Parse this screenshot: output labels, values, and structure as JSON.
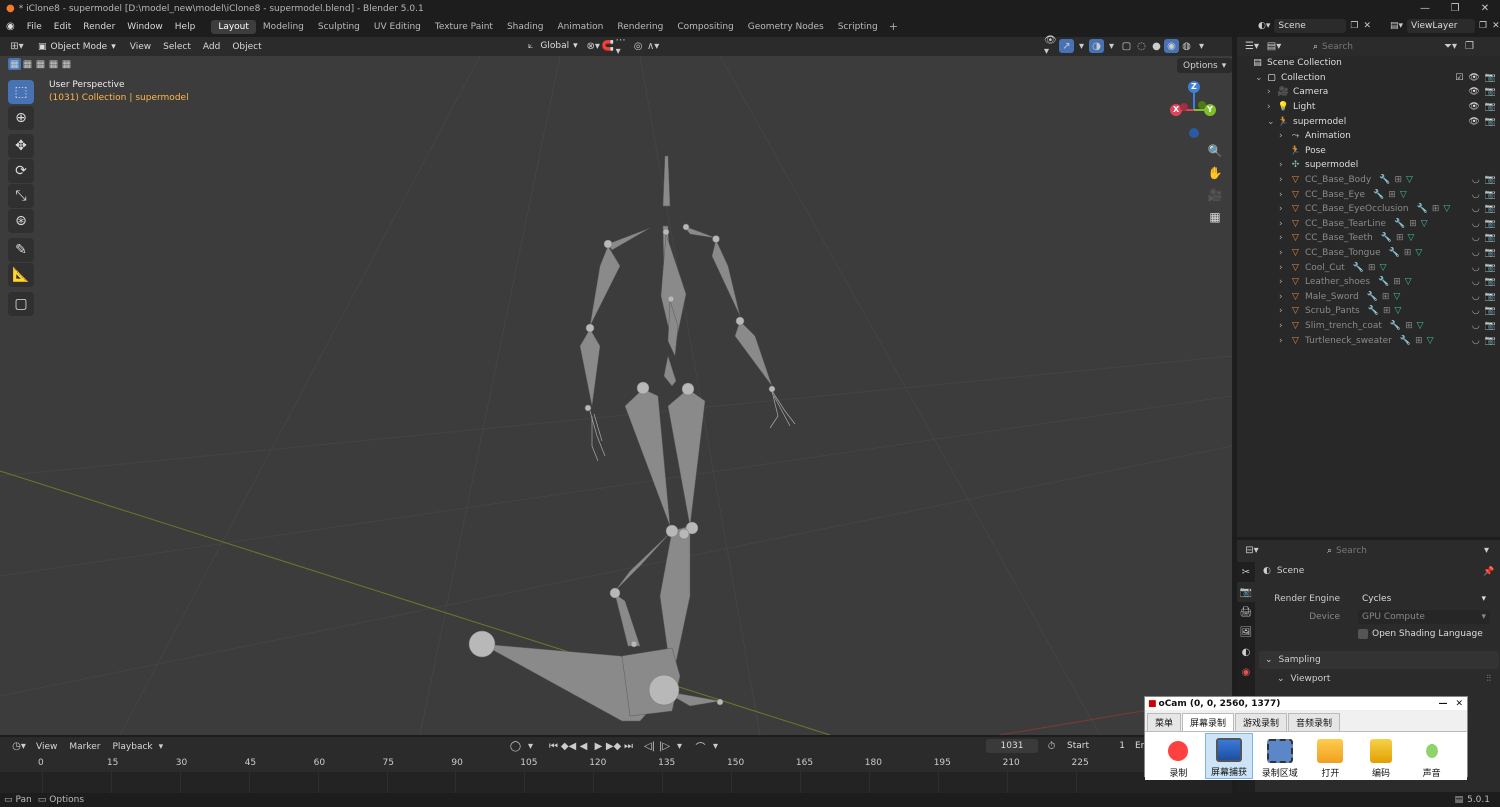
{
  "window": {
    "title": "* iClone8 - supermodel [D:\\model_new\\model\\iClone8 - supermodel.blend] - Blender 5.0.1"
  },
  "menu": [
    "File",
    "Edit",
    "Render",
    "Window",
    "Help"
  ],
  "workspaces": [
    "Layout",
    "Modeling",
    "Sculpting",
    "UV Editing",
    "Texture Paint",
    "Shading",
    "Animation",
    "Rendering",
    "Compositing",
    "Geometry Nodes",
    "Scripting"
  ],
  "active_workspace": "Layout",
  "scene": {
    "name": "Scene",
    "view_layer": "ViewLayer"
  },
  "viewport": {
    "mode": "Object Mode",
    "menus": [
      "View",
      "Select",
      "Add",
      "Object"
    ],
    "orientation": "Global",
    "options_label": "Options",
    "perspective_label": "User Perspective",
    "context_label": "(1031) Collection | supermodel",
    "context_frame": "(1031) Collection",
    "context_object": "supermodel",
    "gizmo": {
      "x": "X",
      "y": "Y",
      "z": "Z"
    }
  },
  "outliner": {
    "search_placeholder": "Search",
    "root": "Scene Collection",
    "rows": [
      {
        "name": "Collection",
        "icon": "collection-icon",
        "depth": 1,
        "check": true
      },
      {
        "name": "Camera",
        "icon": "camera-icon",
        "depth": 2
      },
      {
        "name": "Light",
        "icon": "light-icon",
        "depth": 2
      },
      {
        "name": "supermodel",
        "icon": "armature-icon",
        "depth": 2,
        "expanded": true
      },
      {
        "name": "Animation",
        "icon": "animation-icon",
        "depth": 3
      },
      {
        "name": "Pose",
        "icon": "pose-icon",
        "depth": 3
      },
      {
        "name": "supermodel",
        "icon": "armature-data-icon",
        "depth": 3
      },
      {
        "name": "CC_Base_Body",
        "icon": "mesh-icon",
        "depth": 3,
        "dim": true
      },
      {
        "name": "CC_Base_Eye",
        "icon": "mesh-icon",
        "depth": 3,
        "dim": true
      },
      {
        "name": "CC_Base_EyeOcclusion",
        "icon": "mesh-icon",
        "depth": 3,
        "dim": true
      },
      {
        "name": "CC_Base_TearLine",
        "icon": "mesh-icon",
        "depth": 3,
        "dim": true
      },
      {
        "name": "CC_Base_Teeth",
        "icon": "mesh-icon",
        "depth": 3,
        "dim": true
      },
      {
        "name": "CC_Base_Tongue",
        "icon": "mesh-icon",
        "depth": 3,
        "dim": true
      },
      {
        "name": "Cool_Cut",
        "icon": "mesh-icon",
        "depth": 3,
        "dim": true
      },
      {
        "name": "Leather_shoes",
        "icon": "mesh-icon",
        "depth": 3,
        "dim": true
      },
      {
        "name": "Male_Sword",
        "icon": "mesh-icon",
        "depth": 3,
        "dim": true
      },
      {
        "name": "Scrub_Pants",
        "icon": "mesh-icon",
        "depth": 3,
        "dim": true
      },
      {
        "name": "Slim_trench_coat",
        "icon": "mesh-icon",
        "depth": 3,
        "dim": true
      },
      {
        "name": "Turtleneck_sweater",
        "icon": "mesh-icon",
        "depth": 3,
        "dim": true
      }
    ]
  },
  "properties": {
    "search_placeholder": "Search",
    "context": "Scene",
    "render_engine_label": "Render Engine",
    "render_engine": "Cycles",
    "device_label": "Device",
    "device": "GPU Compute",
    "osl_label": "Open Shading Language",
    "sampling_label": "Sampling",
    "viewport_label": "Viewport"
  },
  "timeline": {
    "menus": [
      "View",
      "Marker",
      "Playback"
    ],
    "current_frame": "1031",
    "start_label": "Start",
    "start_value": "1",
    "end_label": "En",
    "ticks": [
      "0",
      "15",
      "30",
      "45",
      "60",
      "75",
      "90",
      "105",
      "120",
      "135",
      "150",
      "165",
      "180",
      "195",
      "210",
      "225"
    ]
  },
  "statusbar": {
    "left1": "Pan",
    "left2": "Options",
    "version": "5.0.1"
  },
  "ocam": {
    "title": "oCam (0, 0, 2560, 1377)",
    "tabs": [
      "菜单",
      "屏幕录制",
      "游戏录制",
      "音频录制"
    ],
    "active_tab": "屏幕录制",
    "buttons": [
      {
        "label": "录制",
        "icon": "record-icon"
      },
      {
        "label": "屏幕捕获",
        "icon": "screen-capture-icon"
      },
      {
        "label": "录制区域",
        "icon": "record-area-icon"
      },
      {
        "label": "打开",
        "icon": "folder-icon"
      },
      {
        "label": "编码",
        "icon": "encode-icon"
      },
      {
        "label": "声音",
        "icon": "microphone-icon"
      }
    ]
  },
  "colors": {
    "accent": "#4772b3",
    "context_label": "#ffb84d",
    "x_axis": "#e0445a",
    "y_axis": "#7fbf2a",
    "z_axis": "#3d7fd9"
  }
}
